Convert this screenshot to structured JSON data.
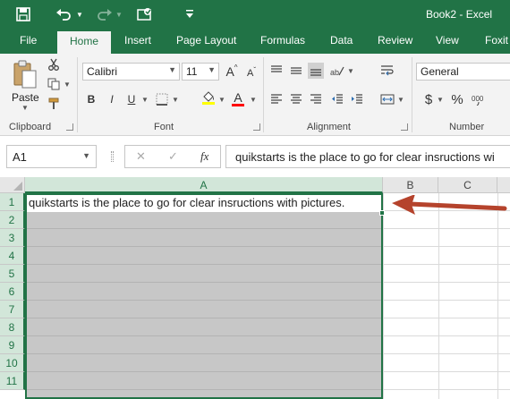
{
  "app": {
    "title": "Book2  -  Excel",
    "accent_color": "#217346",
    "qat_icons": [
      "save-icon",
      "undo-icon",
      "redo-icon",
      "touch-mode-icon",
      "customize-qat-icon"
    ]
  },
  "tabs": [
    "File",
    "Home",
    "Insert",
    "Page Layout",
    "Formulas",
    "Data",
    "Review",
    "View",
    "Foxit"
  ],
  "active_tab": "Home",
  "ribbon": {
    "clipboard": {
      "label": "Clipboard",
      "paste_label": "Paste"
    },
    "font": {
      "label": "Font",
      "font_name": "Calibri",
      "font_size": "11",
      "grow_label": "A",
      "shrink_label": "A",
      "bold": "B",
      "italic": "I",
      "underline": "U",
      "font_color_label": "A",
      "fill_color": "#ffff00",
      "text_color": "#ff0000"
    },
    "alignment": {
      "label": "Alignment"
    },
    "number": {
      "label": "Number",
      "format": "General",
      "currency_symbol": "$",
      "percent_symbol": "%"
    }
  },
  "formula_bar": {
    "name_box": "A1",
    "cancel_glyph": "✕",
    "enter_glyph": "✓",
    "fx_label": "fx",
    "content": "quikstarts is the place to go for clear insructions wi"
  },
  "grid": {
    "columns": [
      "A",
      "B",
      "C"
    ],
    "rows": [
      "1",
      "2",
      "3",
      "4",
      "5",
      "6",
      "7",
      "8",
      "9",
      "10",
      "11"
    ],
    "cells": {
      "A1": "quikstarts is the place to go for clear insructions with pictures."
    },
    "selection_color": "#c7c7c7",
    "annotation_arrow_color": "#b5432c"
  }
}
